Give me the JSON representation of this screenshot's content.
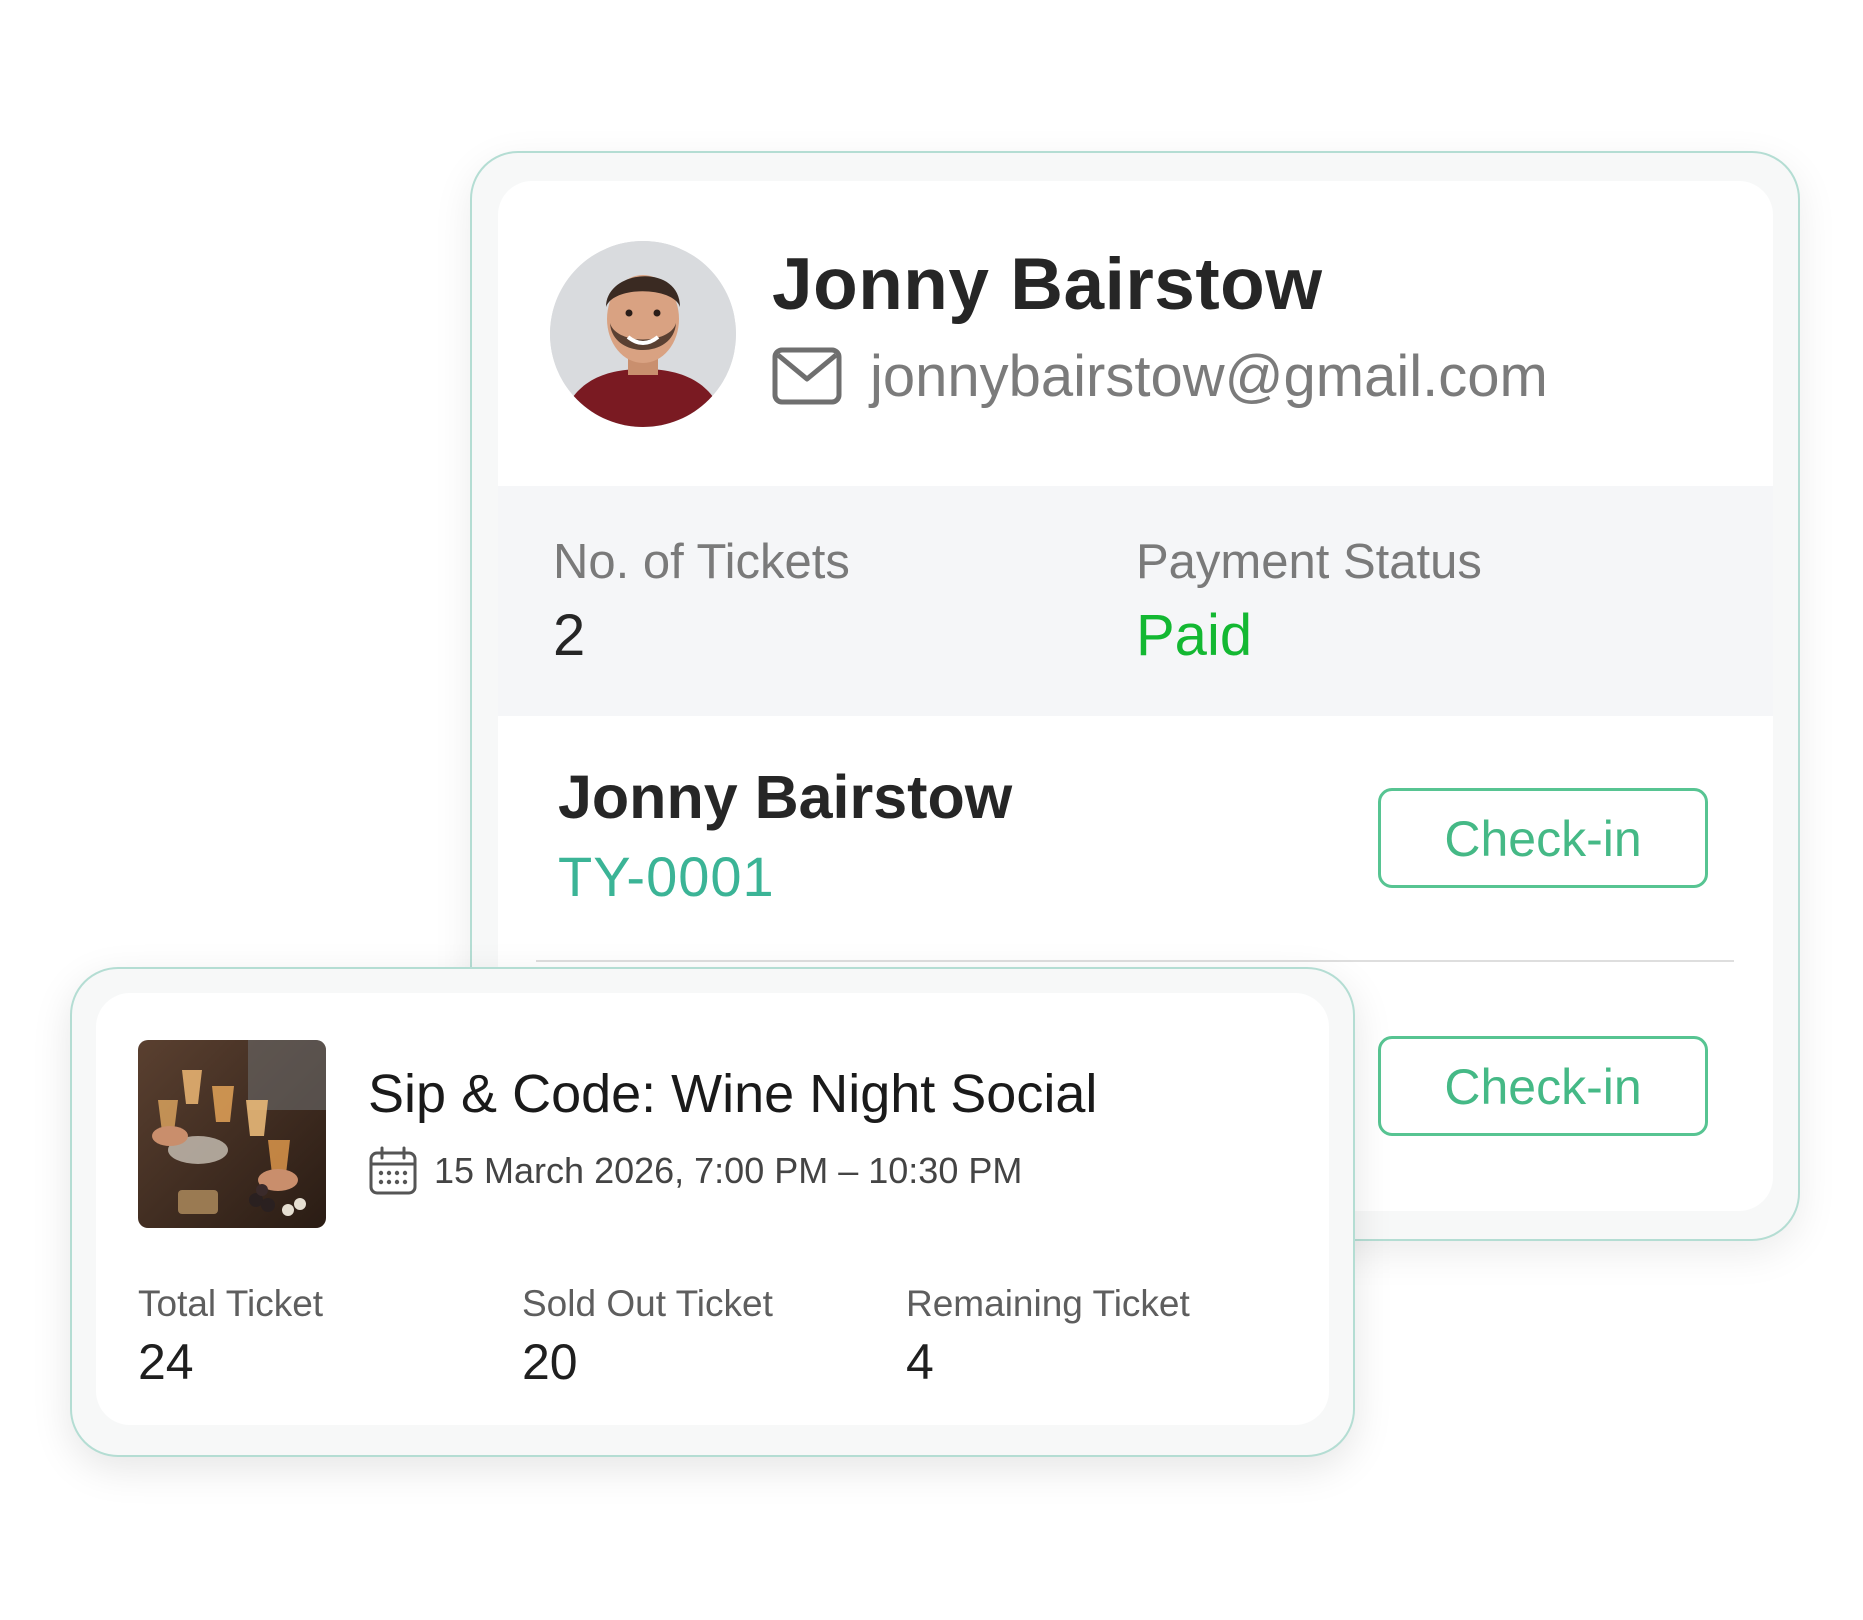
{
  "attendee": {
    "name": "Jonny Bairstow",
    "email": "jonnybairstow@gmail.com",
    "avatar_icon": "person-photo",
    "email_icon": "mail-icon",
    "summary": {
      "tickets_label": "No. of Tickets",
      "tickets_value": "2",
      "payment_label": "Payment Status",
      "payment_value": "Paid",
      "payment_color": "#13b832"
    },
    "tickets": [
      {
        "holder": "Jonny Bairstow",
        "code": "TY-0001",
        "button_label": "Check-in"
      },
      {
        "button_label": "Check-in"
      }
    ]
  },
  "event": {
    "title": "Sip & Code: Wine Night Social",
    "date": "15 March 2026, 7:00 PM – 10:30 PM",
    "date_icon": "calendar-icon",
    "stats": {
      "total_label": "Total Ticket",
      "total_value": "24",
      "sold_label": "Sold Out Ticket",
      "sold_value": "20",
      "remaining_label": "Remaining Ticket",
      "remaining_value": "4"
    }
  },
  "colors": {
    "accent_green": "#45b986",
    "code_teal": "#3bb496",
    "frame_border": "#b4ddd3"
  }
}
